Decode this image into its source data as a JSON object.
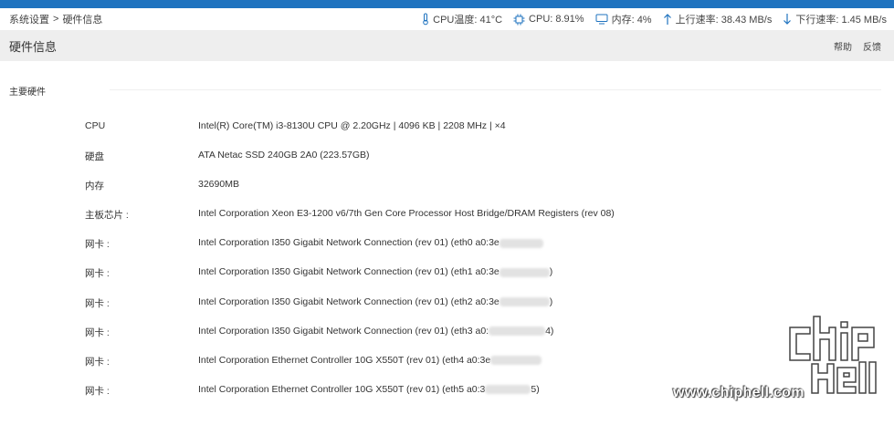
{
  "breadcrumb": {
    "root": "系统设置",
    "separator": ">",
    "current": "硬件信息"
  },
  "status": {
    "cpu_temp": "CPU温度: 41°C",
    "cpu_usage": "CPU: 8.91%",
    "memory": "内存: 4%",
    "upload": "上行速率: 38.43 MB/s",
    "download": "下行速率: 1.45 MB/s"
  },
  "header": {
    "title": "硬件信息",
    "help": "帮助",
    "feedback": "反馈"
  },
  "section": {
    "title": "主要硬件"
  },
  "hardware": [
    {
      "label": "CPU",
      "value": "Intel(R) Core(TM) i3-8130U CPU @ 2.20GHz | 4096 KB | 2208 MHz | ×4"
    },
    {
      "label": "硬盘",
      "value": "ATA Netac SSD 240GB 2A0 (223.57GB)"
    },
    {
      "label": "内存",
      "value": "32690MB"
    },
    {
      "label": "主板芯片 :",
      "value": "Intel Corporation Xeon E3-1200 v6/7th Gen Core Processor Host Bridge/DRAM Registers (rev 08)"
    },
    {
      "label": "网卡 :",
      "value": "Intel Corporation I350 Gigabit Network Connection (rev 01) (eth0 a0:3e",
      "suffix": ""
    },
    {
      "label": "网卡 :",
      "value": "Intel Corporation I350 Gigabit Network Connection (rev 01) (eth1 a0:3e",
      "suffix": ")"
    },
    {
      "label": "网卡 :",
      "value": "Intel Corporation I350 Gigabit Network Connection (rev 01) (eth2 a0:3e",
      "suffix": ")"
    },
    {
      "label": "网卡 :",
      "value": "Intel Corporation I350 Gigabit Network Connection (rev 01) (eth3 a0:",
      "suffix": "4)"
    },
    {
      "label": "网卡 :",
      "value": "Intel Corporation Ethernet Controller 10G X550T (rev 01) (eth4 a0:3e",
      "suffix": ""
    },
    {
      "label": "网卡 :",
      "value": "Intel Corporation Ethernet Controller 10G X550T (rev 01) (eth5 a0:3",
      "suffix": "5)"
    }
  ],
  "watermark": {
    "url": "www.chiphell.com"
  },
  "colors": {
    "accent": "#1f73bf",
    "header_bg": "#eeeeee"
  },
  "icons": {
    "cpu_temp": "thermometer-icon",
    "cpu_usage": "cpu-chip-icon",
    "memory": "monitor-icon",
    "upload": "arrow-up-icon",
    "download": "arrow-down-icon"
  }
}
